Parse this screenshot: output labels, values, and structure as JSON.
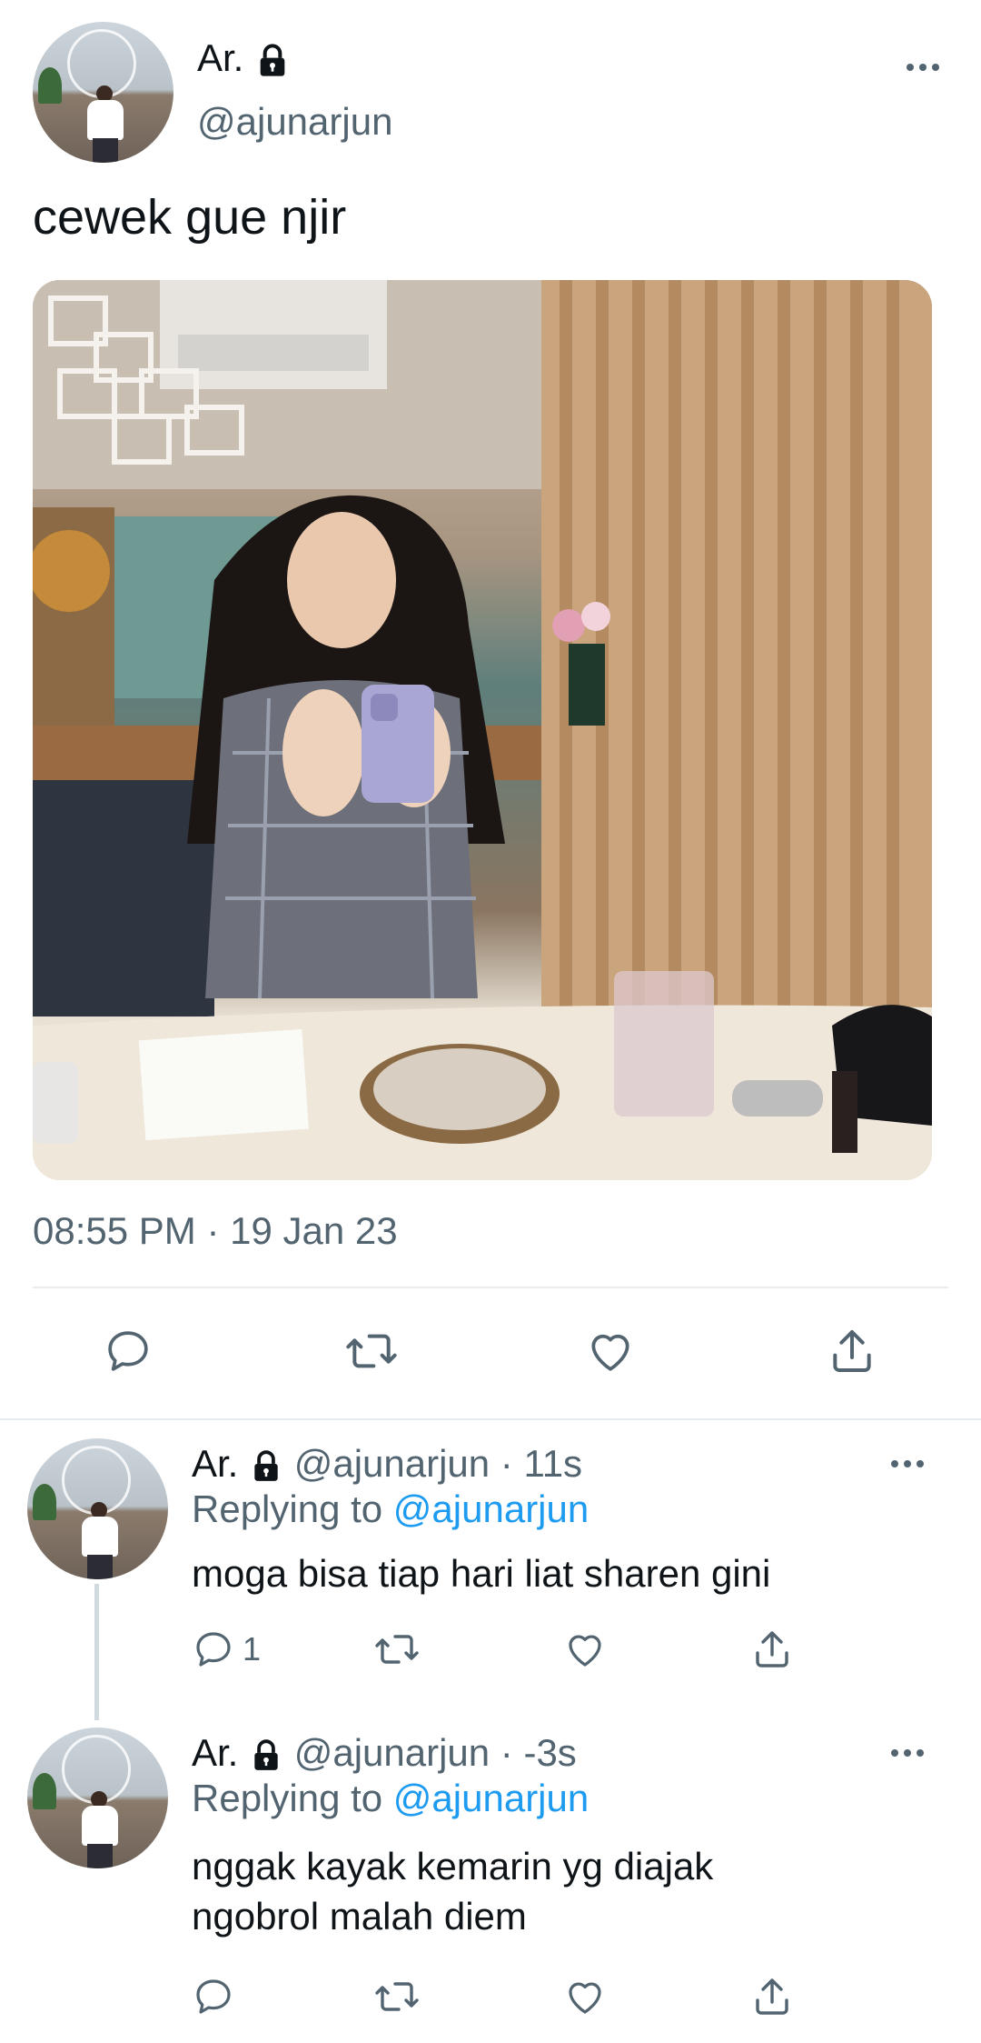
{
  "tweet": {
    "display_name": "Ar.",
    "handle": "@ajunarjun",
    "text": "cewek gue njir",
    "timestamp": "08:55 PM · 19 Jan 23"
  },
  "replies": [
    {
      "display_name": "Ar.",
      "meta": "@ajunarjun · 11s",
      "replying_prefix": "Replying to",
      "replying_handle": "@ajunarjun",
      "text": "moga bisa tiap hari liat sharen gini",
      "reply_count": "1"
    },
    {
      "display_name": "Ar.",
      "meta": "@ajunarjun · -3s",
      "replying_prefix": "Replying to",
      "replying_handle": "@ajunarjun",
      "text_line1": "nggak kayak kemarin yg diajak",
      "text_line2": "ngobrol malah diem",
      "reply_count": ""
    }
  ],
  "icons": {
    "lock": "lock-icon",
    "more": "more-icon",
    "reply": "reply-icon",
    "retweet": "retweet-icon",
    "like": "like-icon",
    "share": "share-icon"
  },
  "colors": {
    "text": "#0f1419",
    "secondary": "#536471",
    "link": "#1d9bf0",
    "divider": "#e6ecf0"
  }
}
